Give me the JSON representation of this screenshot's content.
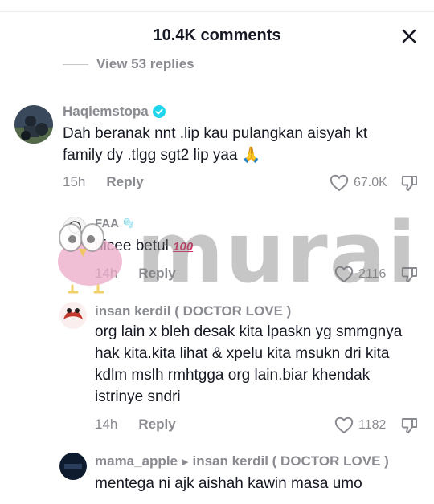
{
  "header": {
    "title": "10.4K comments"
  },
  "view_replies": "View 53 replies",
  "comments": [
    {
      "username": "Haqiemstopa",
      "text": "Dah beranak nnt .lip kau pulangkan aisyah kt family dy .tlgg sgt2 lip yaa 🙏",
      "time": "15h",
      "reply_label": "Reply",
      "likes": "67.0K"
    },
    {
      "username": "FAA",
      "username_suffix": "🫧",
      "text": "nicee betul",
      "emoji": "100",
      "time": "14h",
      "reply_label": "Reply",
      "likes": "2116"
    },
    {
      "username": "insan kerdil ( DOCTOR LOVE )",
      "text": "org lain x bleh desak kita lpaskn yg smmgnya hak kita.kita lihat & xpelu kita msukn dri kita kdlm mslh rmhtgga org lain.biar khendak istrinye sndri",
      "time": "14h",
      "reply_label": "Reply",
      "likes": "1182"
    },
    {
      "username": "mama_apple",
      "reply_to": "insan kerdil ( DOCTOR LOVE )",
      "text": "mentega ni ajk aishah kawin masa umo"
    }
  ],
  "watermark": "murai",
  "colors": {
    "text": "#161823",
    "muted": "#8a8b91",
    "verified": "#20d5ec",
    "watermark": "#7a7a7a"
  }
}
